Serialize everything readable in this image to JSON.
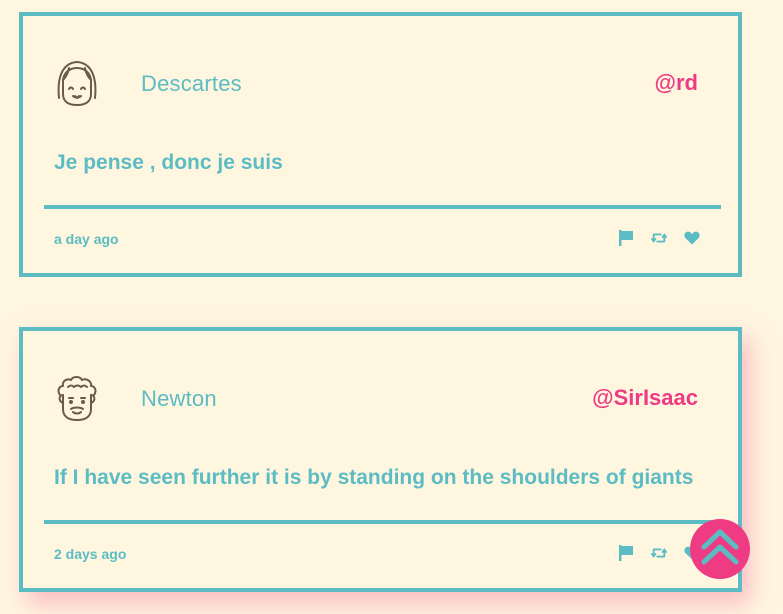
{
  "colors": {
    "background": "#fff6e0",
    "accent": "#5bbcc4",
    "handle": "#ee3b84",
    "avatar_stroke": "#6b5a4a"
  },
  "tweets": [
    {
      "author": "Descartes",
      "handle": "@rd",
      "text": "Je pense , donc je suis",
      "time": "a day ago",
      "avatar": "girl-avatar-icon",
      "actions": [
        "flag-icon",
        "retweet-icon",
        "heart-icon"
      ]
    },
    {
      "author": "Newton",
      "handle": "@SirIsaac",
      "text": "If I have seen further it is by standing on the shoulders of giants",
      "time": "2 days ago",
      "avatar": "curly-hair-avatar-icon",
      "actions": [
        "flag-icon",
        "retweet-icon",
        "heart-icon"
      ]
    }
  ],
  "scroll_top": {
    "icon": "double-chevron-up-icon"
  }
}
